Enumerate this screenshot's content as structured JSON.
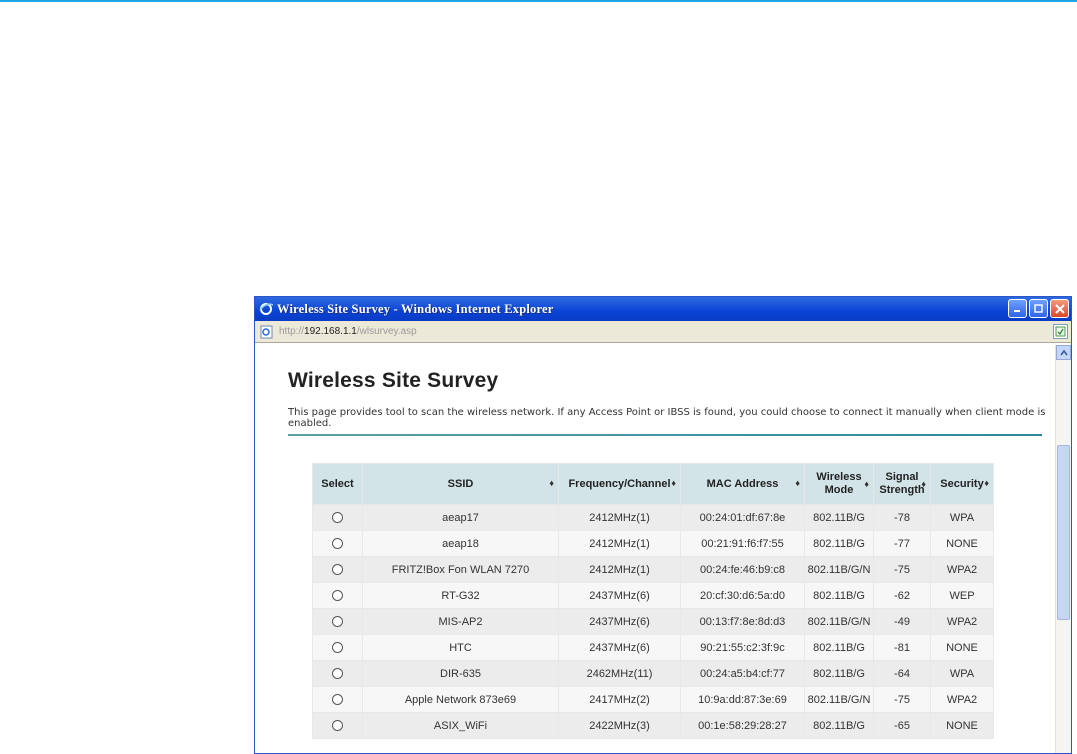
{
  "window": {
    "title": "Wireless Site Survey - Windows Internet Explorer",
    "url_prefix": "http://",
    "url_host": "192.168.1.1",
    "url_path": "/wlsurvey.asp"
  },
  "page": {
    "title": "Wireless Site Survey",
    "description": "This page provides tool to scan the wireless network. If any Access Point or IBSS is found, you could choose to connect it manually when client mode is enabled."
  },
  "table": {
    "headers": {
      "select": "Select",
      "ssid": "SSID",
      "freq": "Frequency/Channel",
      "mac": "MAC Address",
      "mode_1": "Wireless",
      "mode_2": "Mode",
      "signal_1": "Signal",
      "signal_2": "Strength",
      "security": "Security"
    },
    "sort_glyph": "♦",
    "rows": [
      {
        "ssid": "aeap17",
        "freq": "2412MHz(1)",
        "mac": "00:24:01:df:67:8e",
        "mode": "802.11B/G",
        "signal": "-78",
        "security": "WPA"
      },
      {
        "ssid": "aeap18",
        "freq": "2412MHz(1)",
        "mac": "00:21:91:f6:f7:55",
        "mode": "802.11B/G",
        "signal": "-77",
        "security": "NONE"
      },
      {
        "ssid": "FRITZ!Box Fon WLAN 7270",
        "freq": "2412MHz(1)",
        "mac": "00:24:fe:46:b9:c8",
        "mode": "802.11B/G/N",
        "signal": "-75",
        "security": "WPA2"
      },
      {
        "ssid": "RT-G32",
        "freq": "2437MHz(6)",
        "mac": "20:cf:30:d6:5a:d0",
        "mode": "802.11B/G",
        "signal": "-62",
        "security": "WEP"
      },
      {
        "ssid": "MIS-AP2",
        "freq": "2437MHz(6)",
        "mac": "00:13:f7:8e:8d:d3",
        "mode": "802.11B/G/N",
        "signal": "-49",
        "security": "WPA2"
      },
      {
        "ssid": "HTC",
        "freq": "2437MHz(6)",
        "mac": "90:21:55:c2:3f:9c",
        "mode": "802.11B/G",
        "signal": "-81",
        "security": "NONE"
      },
      {
        "ssid": "DIR-635",
        "freq": "2462MHz(11)",
        "mac": "00:24:a5:b4:cf:77",
        "mode": "802.11B/G",
        "signal": "-64",
        "security": "WPA"
      },
      {
        "ssid": "Apple Network 873e69",
        "freq": "2417MHz(2)",
        "mac": "10:9a:dd:87:3e:69",
        "mode": "802.11B/G/N",
        "signal": "-75",
        "security": "WPA2"
      },
      {
        "ssid": "ASIX_WiFi",
        "freq": "2422MHz(3)",
        "mac": "00:1e:58:29:28:27",
        "mode": "802.11B/G",
        "signal": "-65",
        "security": "NONE"
      }
    ]
  },
  "colors": {
    "titlebar": "#0a43d6",
    "header_bg": "#d3e4e8",
    "rule": "#2a8a9a"
  },
  "icons": [
    "ie-logo-icon",
    "minimize-icon",
    "maximize-icon",
    "close-icon",
    "page-icon",
    "compatibility-icon",
    "scroll-up-icon",
    "sort-icon"
  ]
}
